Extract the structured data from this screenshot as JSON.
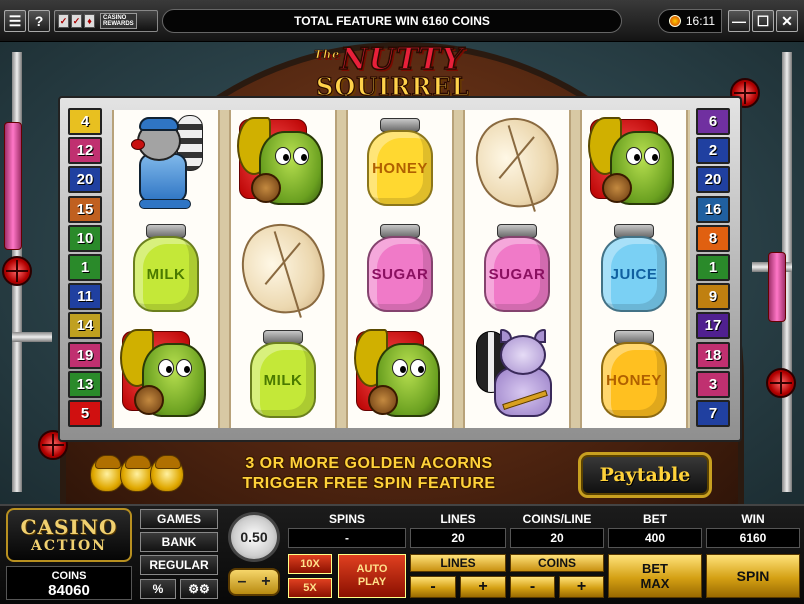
{
  "titlebar": {
    "menu_glyph": "☰",
    "help_label": "?",
    "icon_names": [
      "checkmark-icon",
      "checkmark-icon",
      "trophy-icon"
    ],
    "casino_rewards_line1": "CASINO",
    "casino_rewards_line2": "REWARDS",
    "message": "TOTAL FEATURE WIN 6160 COINS",
    "clock": "16:11",
    "minimize_glyph": "—",
    "maximize_glyph": "☐",
    "close_glyph": "✕"
  },
  "logo": {
    "line1_small": "The",
    "line1": "NUTTY",
    "line2": "SQUIRREL"
  },
  "paylines_left": [
    {
      "n": "4",
      "color": "#e8c020"
    },
    {
      "n": "12",
      "color": "#c03070"
    },
    {
      "n": "20",
      "color": "#2040a0"
    },
    {
      "n": "15",
      "color": "#c06020"
    },
    {
      "n": "10",
      "color": "#2a8a2a"
    },
    {
      "n": "1",
      "color": "#2a8a2a"
    },
    {
      "n": "11",
      "color": "#2040a0"
    },
    {
      "n": "14",
      "color": "#c0a020"
    },
    {
      "n": "19",
      "color": "#c03070"
    },
    {
      "n": "13",
      "color": "#2a8a2a"
    },
    {
      "n": "5",
      "color": "#d01010"
    }
  ],
  "paylines_right": [
    {
      "n": "6",
      "color": "#7030a0"
    },
    {
      "n": "2",
      "color": "#2040a0"
    },
    {
      "n": "20",
      "color": "#2040a0"
    },
    {
      "n": "16",
      "color": "#2060a0"
    },
    {
      "n": "8",
      "color": "#e06010"
    },
    {
      "n": "1",
      "color": "#2a8a2a"
    },
    {
      "n": "9",
      "color": "#c08010"
    },
    {
      "n": "17",
      "color": "#502090"
    },
    {
      "n": "18",
      "color": "#c03070"
    },
    {
      "n": "3",
      "color": "#c03070"
    },
    {
      "n": "7",
      "color": "#2040a0"
    }
  ],
  "reels": [
    [
      {
        "type": "robber"
      },
      {
        "type": "jar",
        "label": "MILK",
        "color": "#c4e838",
        "text": "#4a7a00"
      },
      {
        "type": "squirrel"
      }
    ],
    [
      {
        "type": "squirrel"
      },
      {
        "type": "leaf"
      },
      {
        "type": "jar",
        "label": "MILK",
        "color": "#c4e838",
        "text": "#4a7a00"
      }
    ],
    [
      {
        "type": "jar",
        "label": "HONEY",
        "color": "#ffd830",
        "text": "#b06000"
      },
      {
        "type": "jar",
        "label": "SUGAR",
        "color": "#f07ac8",
        "text": "#8a1060"
      },
      {
        "type": "squirrel"
      }
    ],
    [
      {
        "type": "leaf"
      },
      {
        "type": "jar",
        "label": "SUGAR",
        "color": "#f07ac8",
        "text": "#8a1060"
      },
      {
        "type": "skunk"
      }
    ],
    [
      {
        "type": "squirrel"
      },
      {
        "type": "jar",
        "label": "JUICE",
        "color": "#7ad0f4",
        "text": "#1060a0"
      },
      {
        "type": "jar",
        "label": "HONEY",
        "color": "#ffc020",
        "text": "#b06000"
      }
    ]
  ],
  "feature": {
    "line1": "3 OR MORE GOLDEN ACORNS",
    "line2": "TRIGGER FREE SPIN FEATURE"
  },
  "paytable_label": "Paytable",
  "console": {
    "logo_line1": "CASINO",
    "logo_line2": "ACTION",
    "coins_label": "COINS",
    "coins_value": "84060",
    "games_label": "GAMES",
    "bank_label": "BANK",
    "regular_label": "REGULAR",
    "percent_label": "%",
    "settings_glyph": "⚙⚙",
    "coin_size": "0.50",
    "coin_minus": "–",
    "coin_plus": "+",
    "spins_label": "SPINS",
    "spins_value": "-",
    "lines_label": "LINES",
    "lines_value": "20",
    "coins_per_line_label": "COINS/LINE",
    "coins_per_line_value": "20",
    "bet_label": "BET",
    "bet_value": "400",
    "win_label": "WIN",
    "win_value": "6160",
    "x10_label": "10X",
    "x5_label": "5X",
    "autoplay_line1": "AUTO",
    "autoplay_line2": "PLAY",
    "lines_btn_label": "LINES",
    "lines_minus": "-",
    "lines_plus": "+",
    "coins_btn_label": "COINS",
    "coins_minus": "-",
    "coins_plus": "+",
    "betmax_line1": "BET",
    "betmax_line2": "MAX",
    "spin_label": "SPIN"
  }
}
